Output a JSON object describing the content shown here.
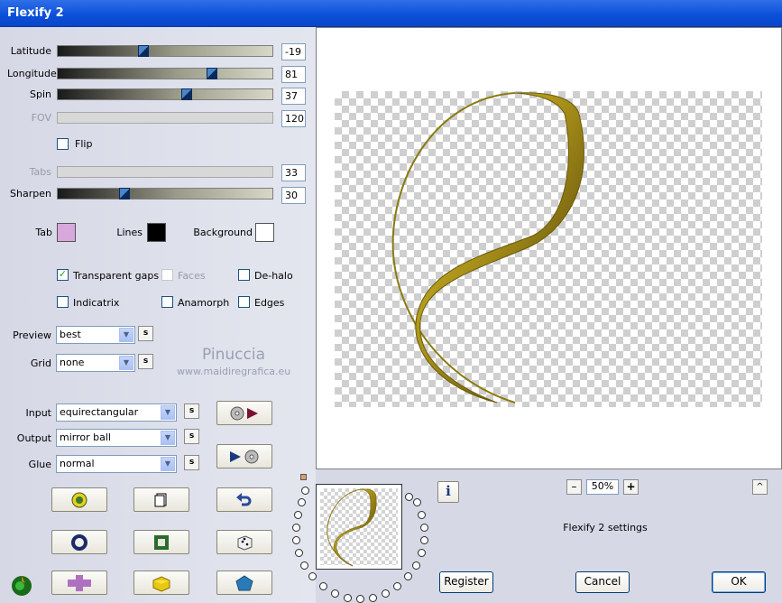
{
  "window": {
    "title": "Flexify 2"
  },
  "sliders": [
    {
      "label": "Latitude",
      "value": "-19",
      "level": 0.4,
      "enabled": true
    },
    {
      "label": "Longitude",
      "value": "81",
      "level": 0.72,
      "enabled": true
    },
    {
      "label": "Spin",
      "value": "37",
      "level": 0.6,
      "enabled": true
    },
    {
      "label": "FOV",
      "value": "120",
      "level": null,
      "enabled": false
    },
    {
      "label": "Tabs",
      "value": "33",
      "level": null,
      "enabled": false
    },
    {
      "label": "Sharpen",
      "value": "30",
      "level": 0.31,
      "enabled": true
    }
  ],
  "flip": {
    "label": "Flip",
    "checked": false
  },
  "colors": {
    "tab": {
      "label": "Tab",
      "color": "#d8a8dc"
    },
    "lines": {
      "label": "Lines",
      "color": "#000000"
    },
    "background": {
      "label": "Background",
      "color": "#ffffff"
    }
  },
  "options": {
    "transparent_gaps": {
      "label": "Transparent gaps",
      "checked": true
    },
    "faces": {
      "label": "Faces",
      "checked": false,
      "enabled": false
    },
    "de_halo": {
      "label": "De-halo",
      "checked": false
    },
    "indicatrix": {
      "label": "Indicatrix",
      "checked": false
    },
    "anamorph": {
      "label": "Anamorph",
      "checked": false
    },
    "edges": {
      "label": "Edges",
      "checked": false
    }
  },
  "preview": {
    "label": "Preview",
    "value": "best"
  },
  "grid": {
    "label": "Grid",
    "value": "none"
  },
  "input": {
    "label": "Input",
    "value": "equirectangular"
  },
  "output": {
    "label": "Output",
    "value": "mirror ball"
  },
  "glue": {
    "label": "Glue",
    "value": "normal"
  },
  "s_label": "s",
  "watermark": {
    "name": "Pinuccia",
    "url": "www.maidiregrafica.eu"
  },
  "zoom": {
    "minus": "–",
    "value": "50%",
    "plus": "+"
  },
  "caret": "^",
  "info": "i",
  "settings_text": "Flexify 2 settings",
  "buttons": {
    "register": "Register",
    "cancel": "Cancel",
    "ok": "OK"
  }
}
